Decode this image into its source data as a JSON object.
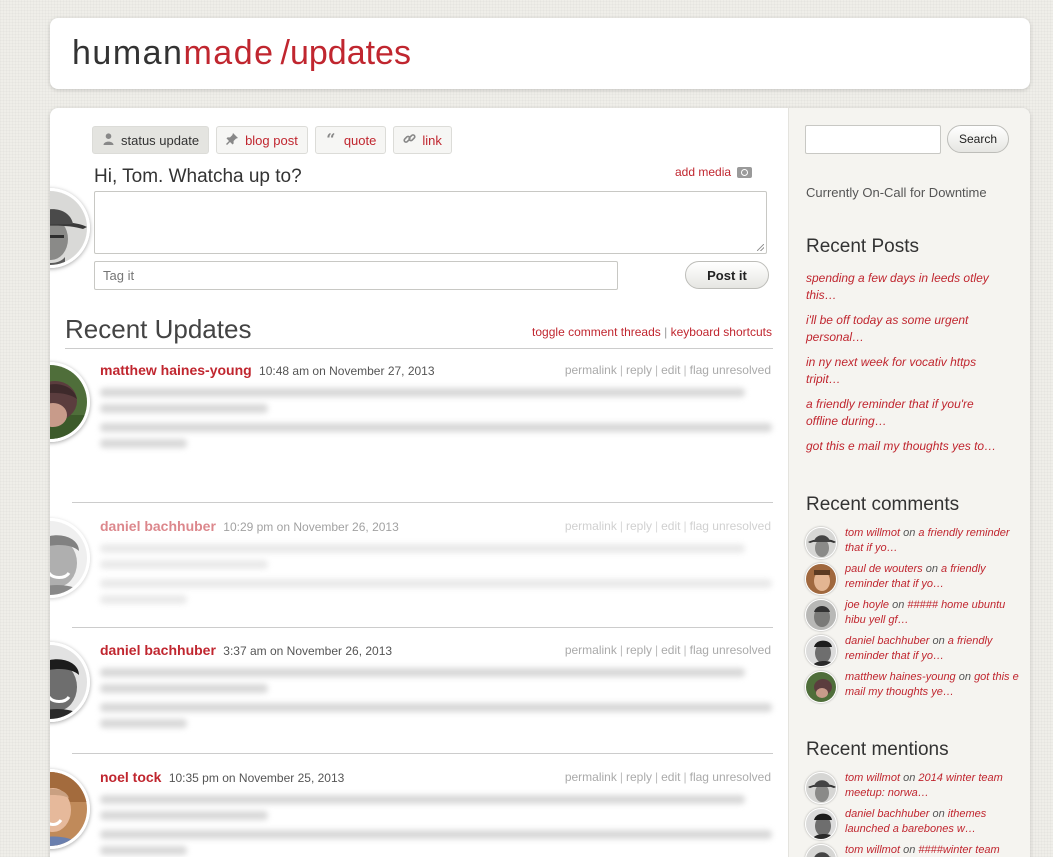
{
  "header": {
    "logo_human": "human",
    "logo_made": "made",
    "logo_section": "/updates"
  },
  "composer": {
    "tabs": [
      {
        "label": "status update",
        "icon": "person-icon"
      },
      {
        "label": "blog post",
        "icon": "pin-icon"
      },
      {
        "label": "quote",
        "icon": "quote-icon"
      },
      {
        "label": "link",
        "icon": "link-icon"
      }
    ],
    "greeting": "Hi, Tom. Whatcha up to?",
    "add_media": "add media",
    "tag_placeholder": "Tag it",
    "post_button": "Post it"
  },
  "feed": {
    "heading": "Recent Updates",
    "toggle_threads": "toggle comment threads",
    "keyboard_shortcuts": "keyboard shortcuts",
    "separator": "|",
    "action_labels": {
      "permalink": "permalink",
      "reply": "reply",
      "edit": "edit",
      "flag": "flag unresolved"
    },
    "posts": [
      {
        "author": "matthew haines-young",
        "time": "10:48 am",
        "date_prefix": "on",
        "date": "November 27, 2013"
      },
      {
        "author": "daniel bachhuber",
        "time": "10:29 pm",
        "date_prefix": "on",
        "date": "November 26, 2013"
      },
      {
        "author": "daniel bachhuber",
        "time": "3:37 am",
        "date_prefix": "on",
        "date": "November 26, 2013"
      },
      {
        "author": "noel tock",
        "time": "10:35 pm",
        "date_prefix": "on",
        "date": "November 25, 2013"
      }
    ]
  },
  "sidebar": {
    "search_button": "Search",
    "oncall": "Currently On-Call for Downtime",
    "recent_posts_heading": "Recent Posts",
    "recent_posts": [
      "spending a few days in leeds otley this…",
      "i'll be off today as some urgent personal…",
      "in ny next week for vocativ https tripit…",
      "a friendly reminder that if you're offline during…",
      "got this e mail my thoughts yes to…"
    ],
    "recent_comments_heading": "Recent comments",
    "recent_comments": [
      {
        "who": "tom willmot",
        "on": "on",
        "what": "a friendly reminder that if yo…"
      },
      {
        "who": "paul de wouters",
        "on": "on",
        "what": "a friendly reminder that if yo…"
      },
      {
        "who": "joe hoyle",
        "on": "on",
        "what": "##### home ubuntu hibu yell gf…"
      },
      {
        "who": "daniel bachhuber",
        "on": "on",
        "what": "a friendly reminder that if yo…"
      },
      {
        "who": "matthew haines-young",
        "on": "on",
        "what": "got this e mail my thoughts ye…"
      }
    ],
    "recent_mentions_heading": "Recent mentions",
    "recent_mentions": [
      {
        "who": "tom willmot",
        "on": "on",
        "what": "2014 winter team meetup: norwa…"
      },
      {
        "who": "daniel bachhuber",
        "on": "on",
        "what": "ithemes launched a barebones w…"
      },
      {
        "who": "tom willmot",
        "on": "on",
        "what": "####winter team"
      }
    ]
  }
}
